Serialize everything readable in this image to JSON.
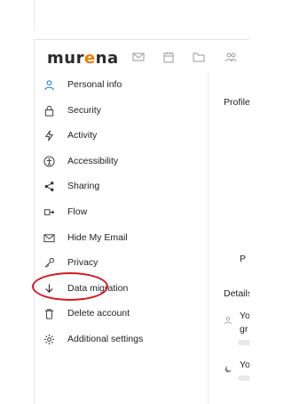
{
  "brand": {
    "logo_pre": "mur",
    "logo_accent": "e",
    "logo_post": "na",
    "accent_color": "#f07d00"
  },
  "header_icons": [
    "mail-icon",
    "calendar-icon",
    "folder-icon",
    "contacts-icon"
  ],
  "sidebar": {
    "items": [
      {
        "label": "Personal info",
        "icon": "user-icon",
        "active": true
      },
      {
        "label": "Security",
        "icon": "lock-icon"
      },
      {
        "label": "Activity",
        "icon": "lightning-icon"
      },
      {
        "label": "Accessibility",
        "icon": "accessibility-icon"
      },
      {
        "label": "Sharing",
        "icon": "share-icon"
      },
      {
        "label": "Flow",
        "icon": "flow-icon"
      },
      {
        "label": "Hide My Email",
        "icon": "mail-icon"
      },
      {
        "label": "Privacy",
        "icon": "key-icon"
      },
      {
        "label": "Data migration",
        "icon": "download-icon"
      },
      {
        "label": "Delete account",
        "icon": "trash-icon"
      },
      {
        "label": "Additional settings",
        "icon": "gear-icon"
      }
    ]
  },
  "content": {
    "profile_partial": "Profile",
    "p_partial": "P",
    "details_partial": "Details",
    "row1_partial": "Yo",
    "row1_sub": "gr",
    "row2_partial": "Yo"
  },
  "colors": {
    "highlight": "#d71920",
    "active_icon": "#1a73e8"
  }
}
